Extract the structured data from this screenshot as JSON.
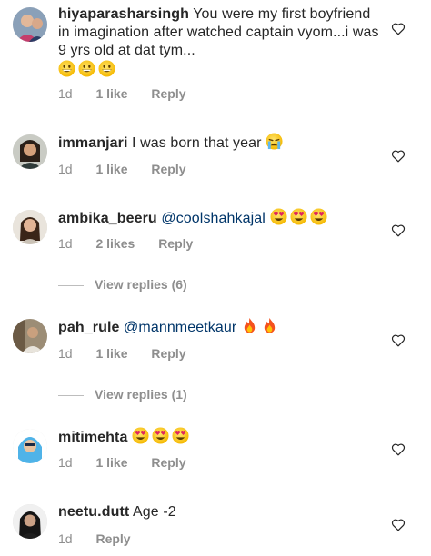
{
  "comments": [
    {
      "username": "hiyaparasharsingh",
      "text": "You were my first boyfriend in imagination after watched captain vyom...i was 9 yrs old at dat tym...",
      "emojis": [
        "grinning",
        "grinning",
        "grinning"
      ],
      "time": "1d",
      "likes": "1 like",
      "reply": "Reply"
    },
    {
      "username": "immanjari",
      "text": "I was born that year",
      "emojis": [
        "crying"
      ],
      "time": "1d",
      "likes": "1 like",
      "reply": "Reply"
    },
    {
      "username": "ambika_beeru",
      "mention": "@coolshahkajal",
      "emojis": [
        "heart-eyes",
        "heart-eyes",
        "heart-eyes"
      ],
      "time": "1d",
      "likes": "2 likes",
      "reply": "Reply",
      "view_replies": "View replies (6)"
    },
    {
      "username": "pah_rule",
      "mention": "@mannmeetkaur",
      "emojis": [
        "fire",
        "fire"
      ],
      "time": "1d",
      "likes": "1 like",
      "reply": "Reply",
      "view_replies": "View replies (1)"
    },
    {
      "username": "mitimehta",
      "emojis": [
        "heart-eyes",
        "heart-eyes",
        "heart-eyes"
      ],
      "time": "1d",
      "likes": "1 like",
      "reply": "Reply"
    },
    {
      "username": "neetu.dutt",
      "text": "Age -2",
      "time": "1d",
      "reply": "Reply"
    }
  ],
  "colors": {
    "mention": "#003569",
    "meta": "#8e8e8e",
    "text": "#262626"
  }
}
